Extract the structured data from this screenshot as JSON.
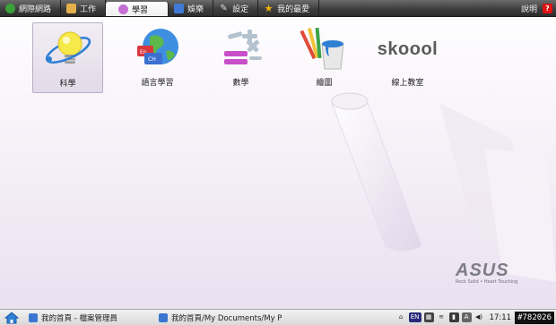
{
  "tabs": [
    {
      "label": "網際網路",
      "icon": "globe-icon",
      "color": "#3aa13a"
    },
    {
      "label": "工作",
      "icon": "folder-icon",
      "color": "#e3b04b"
    },
    {
      "label": "學習",
      "icon": "graduation-icon",
      "color": "#c46fd2",
      "active": true
    },
    {
      "label": "娛樂",
      "icon": "media-icon",
      "color": "#3f7bd6"
    },
    {
      "label": "設定",
      "icon": "wrench-icon",
      "color": "#bdbdbd"
    },
    {
      "label": "我的最愛",
      "icon": "star-icon",
      "color": "#f0b400"
    }
  ],
  "help": {
    "label": "說明",
    "icon": "question-icon"
  },
  "apps": [
    {
      "label": "科學",
      "icon": "lightbulb-atom-icon",
      "selected": true
    },
    {
      "label": "語言學習",
      "icon": "globe-language-icon"
    },
    {
      "label": "數學",
      "icon": "math-symbols-icon"
    },
    {
      "label": "繪圖",
      "icon": "paint-bucket-icon"
    },
    {
      "label": "線上教室",
      "icon": "skoool-logo-icon",
      "logo_text": "skoool"
    }
  ],
  "brand": {
    "logo": "ASUS",
    "tagline": "Rock Solid • Heart Touching"
  },
  "taskbar": {
    "tasks": [
      {
        "label": "我的首頁 - 檔案管理員"
      },
      {
        "label": "我的首頁/My Documents/My P"
      }
    ],
    "tray": {
      "lang": "EN",
      "clock": "17:11",
      "counter": "#782026"
    }
  }
}
